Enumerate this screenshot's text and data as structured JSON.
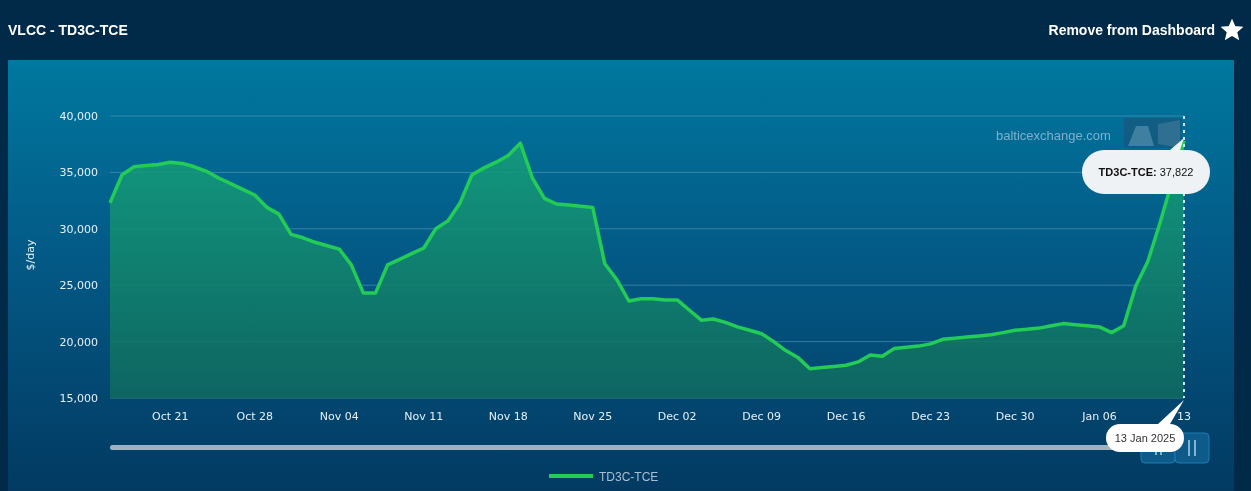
{
  "header": {
    "title": "VLCC - TD3C-TCE",
    "action": "Remove from Dashboard",
    "starred": true
  },
  "chart": {
    "watermark": "balticexchange.com",
    "tooltip": {
      "label": "TD3C-TCE:",
      "value": "37,822"
    },
    "date_tooltip": "13 Jan 2025",
    "chart_data": {
      "type": "area",
      "grid": true,
      "ylabel": "$/day",
      "ylim": [
        15000,
        40000
      ],
      "yticks": [
        {
          "value": 15000,
          "label": "15,000"
        },
        {
          "value": 20000,
          "label": "20,000"
        },
        {
          "value": 25000,
          "label": "25,000"
        },
        {
          "value": 30000,
          "label": "30,000"
        },
        {
          "value": 35000,
          "label": "35,000"
        },
        {
          "value": 40000,
          "label": "40,000"
        }
      ],
      "categories": [
        null,
        null,
        null,
        null,
        null,
        "Oct 21",
        null,
        null,
        null,
        null,
        null,
        null,
        "Oct 28",
        null,
        null,
        null,
        null,
        null,
        null,
        "Nov 04",
        null,
        null,
        null,
        null,
        null,
        null,
        "Nov 11",
        null,
        null,
        null,
        null,
        null,
        null,
        "Nov 18",
        null,
        null,
        null,
        null,
        null,
        null,
        "Nov 25",
        null,
        null,
        null,
        null,
        null,
        null,
        "Dec 02",
        null,
        null,
        null,
        null,
        null,
        null,
        "Dec 09",
        null,
        null,
        null,
        null,
        null,
        null,
        "Dec 16",
        null,
        null,
        null,
        null,
        null,
        null,
        "Dec 23",
        null,
        null,
        null,
        null,
        null,
        null,
        "Dec 30",
        null,
        null,
        null,
        null,
        null,
        null,
        "Jan 06",
        null,
        null,
        null,
        null,
        null,
        null,
        "13"
      ],
      "series": [
        {
          "name": "TD3C-TCE",
          "color": "#22cc55",
          "values": [
            32300,
            34800,
            35500,
            35600,
            35700,
            35900,
            35800,
            35500,
            35100,
            34500,
            34000,
            33500,
            33000,
            31900,
            31300,
            29500,
            29200,
            28800,
            28500,
            28200,
            26800,
            24300,
            24300,
            26800,
            27300,
            27800,
            28300,
            30000,
            30700,
            32300,
            34800,
            35400,
            35900,
            36500,
            37600,
            34500,
            32700,
            32200,
            32100,
            32000,
            31900,
            26900,
            25500,
            23600,
            23800,
            23800,
            23700,
            23700,
            22800,
            21900,
            22000,
            21700,
            21300,
            21000,
            20700,
            20000,
            19200,
            18600,
            17600,
            17700,
            17800,
            17900,
            18200,
            18800,
            18700,
            19400,
            19500,
            19600,
            19800,
            20200,
            20300,
            20400,
            20500,
            20600,
            20800,
            21000,
            21100,
            21200,
            21400,
            21600,
            21500,
            21400,
            21300,
            20800,
            21400,
            24900,
            27100,
            30500,
            null,
            37800
          ]
        }
      ]
    }
  }
}
